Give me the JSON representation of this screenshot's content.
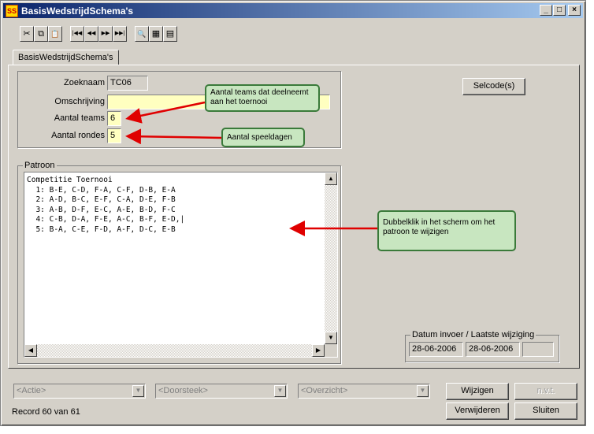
{
  "window": {
    "title": "BasisWedstrijdSchema's",
    "app_icon": "SS"
  },
  "title_buttons": [
    {
      "name": "minimize-button",
      "glyph": "_"
    },
    {
      "name": "maximize-button",
      "glyph": "□"
    },
    {
      "name": "close-button",
      "glyph": "×"
    }
  ],
  "toolbar": {
    "cut": "✂",
    "copy": "⧉",
    "paste": "📋",
    "first": "|◀◀",
    "prev": "◀◀",
    "next": "▶▶",
    "last": "▶▶|",
    "find": "🔍",
    "grid": "▦",
    "form": "▤"
  },
  "tab": {
    "label": "BasisWedstrijdSchema's"
  },
  "form": {
    "zoeknaam_label": "Zoeknaam",
    "zoeknaam_value": "TC06",
    "omschrijving_label": "Omschrijving",
    "omschrijving_value": "",
    "teams_label": "Aantal teams",
    "teams_value": "6",
    "rondes_label": "Aantal rondes",
    "rondes_value": "5"
  },
  "selcode_button": "Selcode(s)",
  "patroon": {
    "label": "Patroon",
    "text": "Competitie Toernooi\n  1: B-E, C-D, F-A, C-F, D-B, E-A\n  2: A-D, B-C, E-F, C-A, D-E, F-B\n  3: A-B, D-F, E-C, A-E, B-D, F-C\n  4: C-B, D-A, F-E, A-C, B-F, E-D,|\n  5: B-A, C-E, F-D, A-F, D-C, E-B"
  },
  "callouts": {
    "teams": "Aantal teams dat deelneemt aan het toernooi",
    "rondes": "Aantal speeldagen",
    "patroon": "Dubbelklik in het scherm om het patroon te wijzigen"
  },
  "datum": {
    "label": "Datum invoer / Laatste wijziging",
    "invoer": "28-06-2006",
    "wijziging": "28-06-2006",
    "extra": ""
  },
  "bottom": {
    "actie": "<Actie>",
    "doorsteek": "<Doorsteek>",
    "overzicht": "<Overzicht>",
    "wijzigen": "Wijzigen",
    "nvt": "n.v.t.",
    "verwijderen": "Verwijderen",
    "sluiten": "Sluiten",
    "record": "Record 60 van 61"
  },
  "colors": {
    "callout_bg": "#c8e6c0",
    "arrow": "#e00000",
    "title_start": "#0a246a"
  }
}
